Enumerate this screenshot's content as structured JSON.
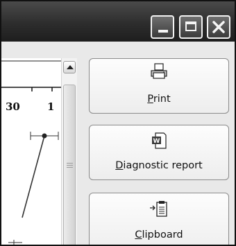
{
  "window": {
    "controls": {
      "minimize": "minimize-icon",
      "maximize": "maximize-icon",
      "close": "close-icon"
    }
  },
  "plot": {
    "tick_labels": [
      "30",
      "1"
    ]
  },
  "actions": {
    "print": {
      "label_accel": "P",
      "label_rest": "rint",
      "icon": "printer-icon"
    },
    "diagnostic_report": {
      "label_accel": "D",
      "label_rest": "iagnostic report",
      "icon": "word-document-icon"
    },
    "clipboard": {
      "label_accel": "C",
      "label_rest": "lipboard",
      "icon": "clipboard-icon"
    }
  }
}
